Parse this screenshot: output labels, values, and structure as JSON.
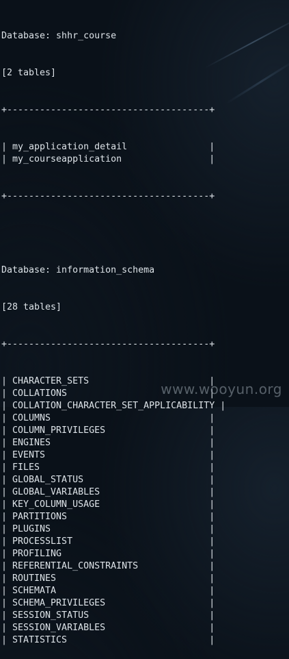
{
  "db1": {
    "header": "Database: shhr_course",
    "count": "[2 tables]",
    "border": "+-------------------------------------+",
    "rows": [
      "| my_application_detail               |",
      "| my_courseapplication                |"
    ]
  },
  "db2": {
    "header": "Database: information_schema",
    "count": "[28 tables]",
    "border": "+-------------------------------------+",
    "rows": [
      "| CHARACTER_SETS                      |",
      "| COLLATIONS                          |",
      "| COLLATION_CHARACTER_SET_APPLICABILITY |",
      "| COLUMNS                             |",
      "| COLUMN_PRIVILEGES                   |",
      "| ENGINES                             |",
      "| EVENTS                              |",
      "| FILES                               |",
      "| GLOBAL_STATUS                       |",
      "| GLOBAL_VARIABLES                    |",
      "| KEY_COLUMN_USAGE                    |",
      "| PARTITIONS                          |",
      "| PLUGINS                             |",
      "| PROCESSLIST                         |",
      "| PROFILING                           |",
      "| REFERENTIAL_CONSTRAINTS             |",
      "| ROUTINES                            |",
      "| SCHEMATA                            |",
      "| SCHEMA_PRIVILEGES                   |",
      "| SESSION_STATUS                      |",
      "| SESSION_VARIABLES                   |",
      "| STATISTICS                          |"
    ]
  },
  "watermark": "www.wooyun.org"
}
